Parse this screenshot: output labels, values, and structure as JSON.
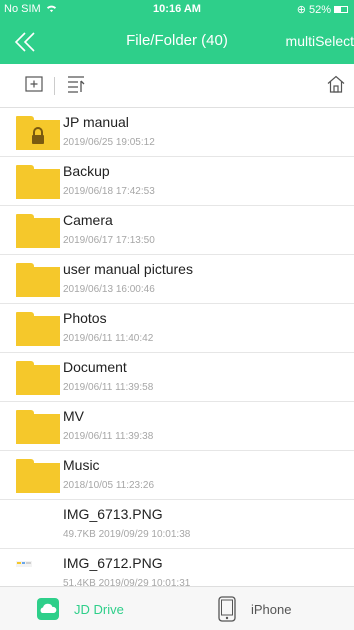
{
  "status": {
    "carrier": "No SIM",
    "time": "10:16 AM",
    "battery": "52%",
    "battery_level": 0.52
  },
  "nav": {
    "title": "File/Folder (40)",
    "multi_select": "multiSelect"
  },
  "colors": {
    "accent": "#2ecf8a",
    "folder": "#f5c82b"
  },
  "items": [
    {
      "name": "JP manual",
      "meta": "2019/06/25 19:05:12",
      "type": "folder-locked"
    },
    {
      "name": "Backup",
      "meta": "2019/06/18 17:42:53",
      "type": "folder"
    },
    {
      "name": "Camera",
      "meta": "2019/06/17 17:13:50",
      "type": "folder"
    },
    {
      "name": "user manual pictures",
      "meta": "2019/06/13 16:00:46",
      "type": "folder"
    },
    {
      "name": "Photos",
      "meta": "2019/06/11 11:40:42",
      "type": "folder"
    },
    {
      "name": "Document",
      "meta": "2019/06/11 11:39:58",
      "type": "folder"
    },
    {
      "name": "MV",
      "meta": "2019/06/11 11:39:38",
      "type": "folder"
    },
    {
      "name": "Music",
      "meta": "2018/10/05 11:23:26",
      "type": "folder"
    },
    {
      "name": "IMG_6713.PNG",
      "meta": "49.7KB 2019/09/29 10:01:38",
      "type": "image"
    },
    {
      "name": "IMG_6712.PNG",
      "meta": "51.4KB 2019/09/29 10:01:31",
      "type": "image-thumb"
    }
  ],
  "tabs": {
    "drive": "JD Drive",
    "phone": "iPhone"
  }
}
